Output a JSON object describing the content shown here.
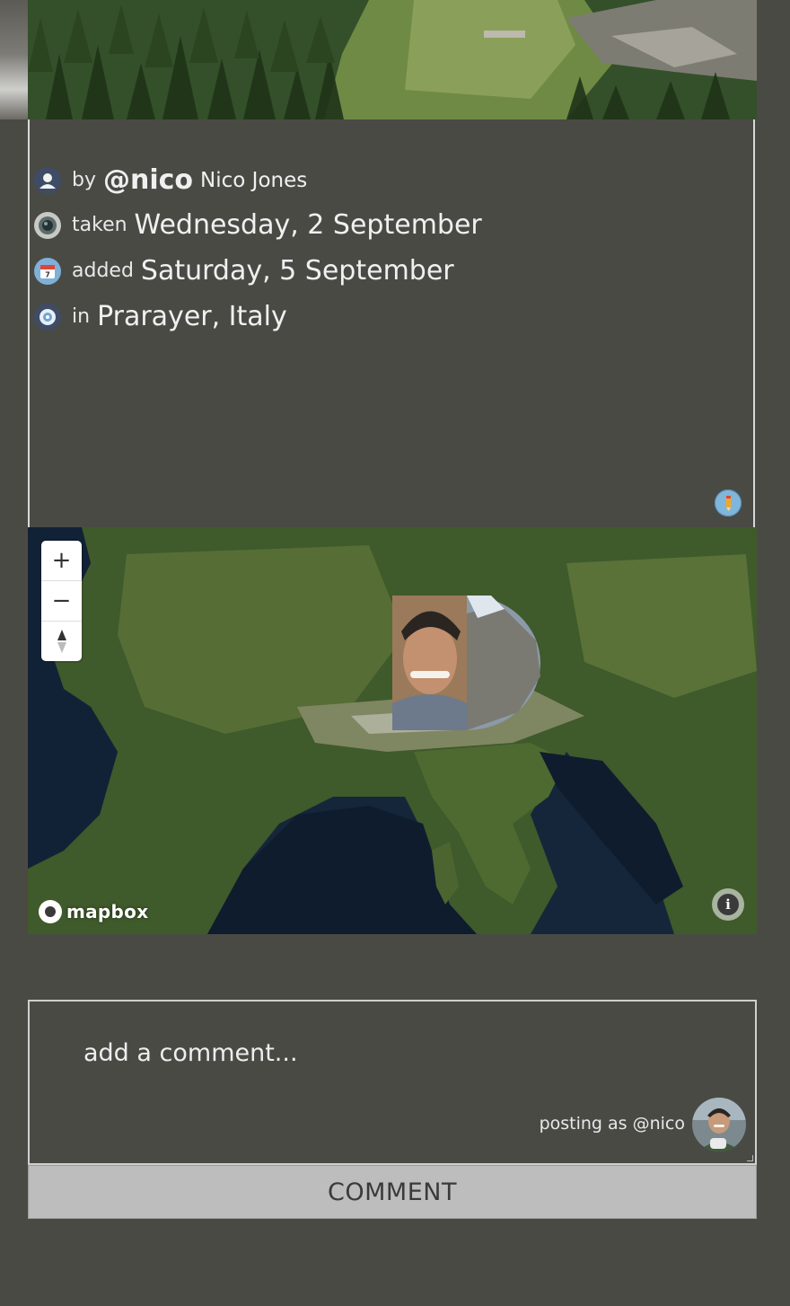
{
  "photo": {
    "alt": "alpine valley with pine forest and rocks"
  },
  "meta": {
    "author": {
      "icon": "user-icon",
      "label": "by",
      "handle": "@nico",
      "name": "Nico Jones"
    },
    "taken": {
      "icon": "camera-lens-icon",
      "label": "taken",
      "value": "Wednesday, 2 September"
    },
    "added": {
      "icon": "calendar-icon",
      "label": "added",
      "value": "Saturday, 5 September"
    },
    "location": {
      "icon": "location-target-icon",
      "label": "in",
      "value": "Prarayer, Italy"
    },
    "edit_icon": "pencil-icon"
  },
  "map": {
    "controls": {
      "zoom_in": "+",
      "zoom_out": "−",
      "compass": "compass-icon"
    },
    "logo_text": "mapbox",
    "info_icon": "i"
  },
  "comment": {
    "placeholder": "add a comment...",
    "posting_as": "posting as @nico",
    "submit_label": "COMMENT"
  },
  "colors": {
    "background": "#4a4a45",
    "panel_border": "#d8d8d8",
    "button_bg": "#bdbdbd",
    "edit_icon_bg": "#7fb6dc",
    "calendar_red": "#e0443a"
  }
}
